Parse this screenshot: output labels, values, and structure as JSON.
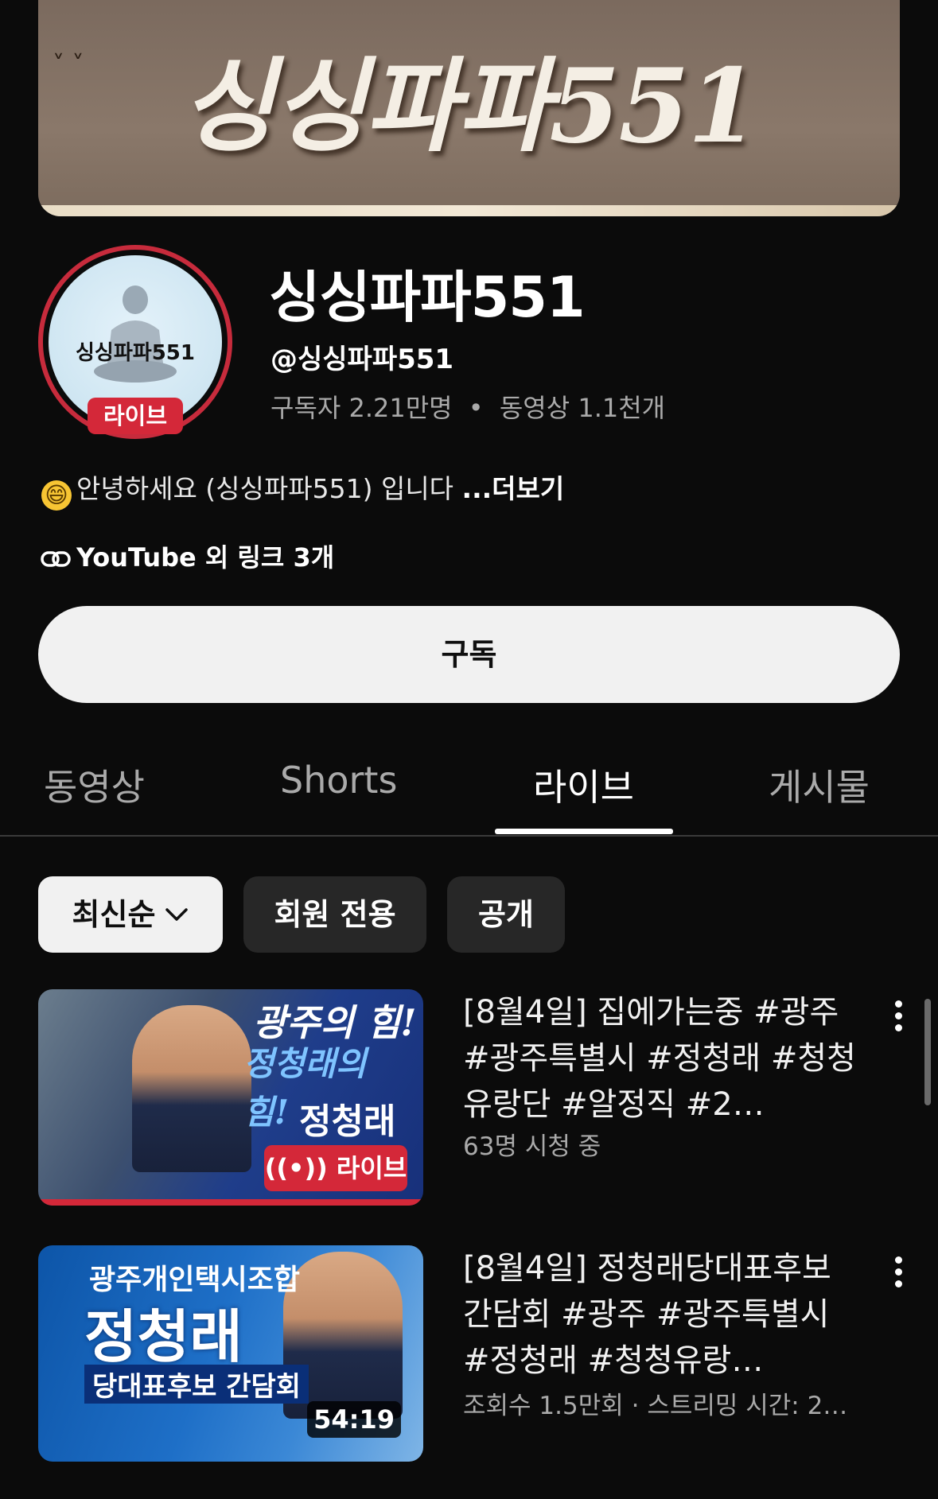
{
  "banner": {
    "title": "싱싱파파551"
  },
  "avatar": {
    "label": "싱싱파파551",
    "live_badge": "라이브"
  },
  "channel": {
    "name": "싱싱파파551",
    "handle": "@싱싱파파551",
    "subscribers": "구독자 2.21만명",
    "separator": "•",
    "videos": "동영상 1.1천개"
  },
  "description": {
    "emoji": "😄",
    "text": "안녕하세요 (싱싱파파551) 입니다 ",
    "more_label": "...더보기"
  },
  "links": {
    "label": "YouTube 외 링크 3개",
    "icon": "link-icon"
  },
  "subscribe": {
    "label": "구독"
  },
  "tabs": [
    {
      "label": "동영상",
      "active": false
    },
    {
      "label": "Shorts",
      "active": false
    },
    {
      "label": "라이브",
      "active": true
    },
    {
      "label": "게시물",
      "active": false
    }
  ],
  "chips": [
    {
      "label": "최신순",
      "selected": true,
      "icon": "chevron-down-icon"
    },
    {
      "label": "회원 전용",
      "selected": false
    },
    {
      "label": "공개",
      "selected": false
    }
  ],
  "videos": [
    {
      "title": "[8월4일] 집에가는중 #광주 #광주특별시 #정청래 #청청유랑단 #알정직 #2…",
      "meta": "63명 시청 중",
      "thumb_headline_1": "광주의 힘!",
      "thumb_headline_2": "정청래의 힘!",
      "thumb_name": "정청래",
      "thumb_badge": "라이브",
      "is_live": true
    },
    {
      "title": "[8월4일] 정청래당대표후보 간담회 #광주 #광주특별시 #정청래 #청청유랑…",
      "meta": "조회수 1.5만회 · 스트리밍 시간: 2…",
      "thumb_headline_1": "광주개인택시조합",
      "thumb_headline_2": "정청래",
      "thumb_name": "당대표후보 간담회",
      "duration": "54:19",
      "is_live": false
    }
  ],
  "colors": {
    "accent": "#d42839",
    "background": "#0b0b0b",
    "chip": "#272727",
    "muted": "#aaaaaa"
  }
}
